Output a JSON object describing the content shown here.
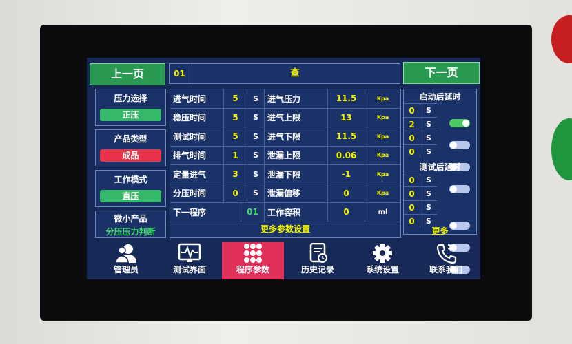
{
  "header": {
    "prev_page": "上一页",
    "next_page": "下一页",
    "program_no": "01",
    "mode_text": "查"
  },
  "left_panel": {
    "pressure_select": {
      "label": "压力选择",
      "value": "正压",
      "color": "#35b86a"
    },
    "product_type": {
      "label": "产品类型",
      "value": "成品",
      "color": "#e8324a"
    },
    "work_mode": {
      "label": "工作模式",
      "value": "直压",
      "color": "#35b86a"
    },
    "small_product": {
      "label": "微小产品",
      "value": "分压压力判断"
    }
  },
  "params_left": [
    {
      "label": "进气时间",
      "value": "5",
      "unit": "S"
    },
    {
      "label": "稳压时间",
      "value": "5",
      "unit": "S"
    },
    {
      "label": "测试时间",
      "value": "5",
      "unit": "S"
    },
    {
      "label": "排气时间",
      "value": "1",
      "unit": "S"
    },
    {
      "label": "定量进气",
      "value": "3",
      "unit": "S"
    },
    {
      "label": "分压时间",
      "value": "0",
      "unit": "S"
    }
  ],
  "next_program": {
    "label": "下一程序",
    "value": "01"
  },
  "params_right": [
    {
      "label": "进气压力",
      "value": "11.5",
      "unit": "Kpa"
    },
    {
      "label": "进气上限",
      "value": "13",
      "unit": "Kpa"
    },
    {
      "label": "进气下限",
      "value": "11.5",
      "unit": "Kpa"
    },
    {
      "label": "泄漏上限",
      "value": "0.06",
      "unit": "Kpa"
    },
    {
      "label": "泄漏下限",
      "value": "-1",
      "unit": "Kpa"
    },
    {
      "label": "泄漏偏移",
      "value": "0",
      "unit": "Kpa"
    },
    {
      "label": "工作容积",
      "value": "0",
      "unit": "ml"
    }
  ],
  "more_params": "更多参数设置",
  "start_delay": {
    "title": "启动后延时",
    "rows": [
      {
        "value": "0",
        "unit": "S",
        "on": true
      },
      {
        "value": "2",
        "unit": "S",
        "on": false
      },
      {
        "value": "0",
        "unit": "S",
        "on": false
      },
      {
        "value": "0",
        "unit": "S",
        "on": false
      }
    ]
  },
  "test_delay": {
    "title": "测试后延时",
    "rows": [
      {
        "value": "0",
        "unit": "S",
        "on": false
      },
      {
        "value": "0",
        "unit": "S",
        "on": false
      },
      {
        "value": "0",
        "unit": "S",
        "on": false
      },
      {
        "value": "0",
        "unit": "S",
        "on": false
      }
    ]
  },
  "more": "更多",
  "nav": [
    {
      "label": "管理员",
      "icon": "users-icon"
    },
    {
      "label": "测试界面",
      "icon": "monitor-icon"
    },
    {
      "label": "程序参数",
      "icon": "grid-icon",
      "active": true
    },
    {
      "label": "历史记录",
      "icon": "history-icon"
    },
    {
      "label": "系统设置",
      "icon": "gear-icon"
    },
    {
      "label": "联系我们",
      "icon": "phone-icon"
    }
  ]
}
